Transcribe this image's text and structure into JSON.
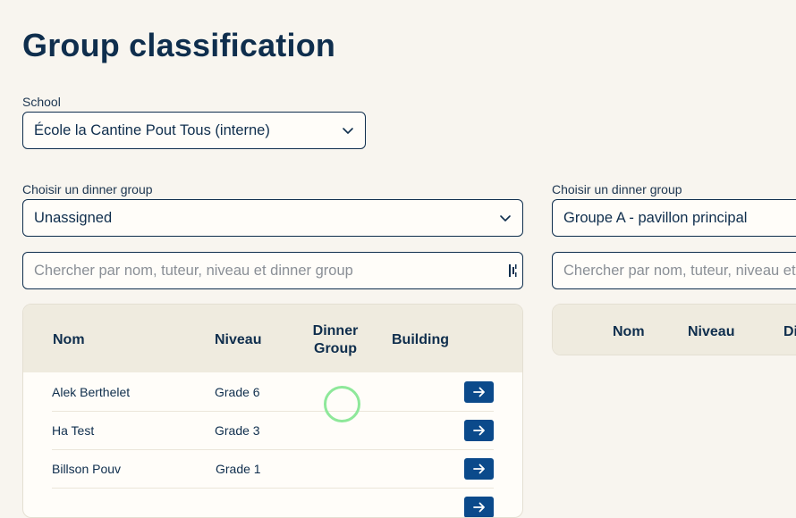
{
  "page": {
    "title": "Group classification"
  },
  "school": {
    "label": "School",
    "selected": "École la Cantine Pout Tous (interne)"
  },
  "left": {
    "group_label": "Choisir un dinner group",
    "group_selected": "Unassigned",
    "search_placeholder": "Chercher par nom, tuteur, niveau et dinner group",
    "table": {
      "headers": {
        "nom": "Nom",
        "niveau": "Niveau",
        "dinner_group_1": "Dinner",
        "dinner_group_2": "Group",
        "building": "Building"
      },
      "rows": [
        {
          "nom": "Alek Berthelet",
          "niveau": "Grade 6"
        },
        {
          "nom": "Ha Test",
          "niveau": "Grade 3"
        },
        {
          "nom": "Billson Pouv",
          "niveau": "Grade 1"
        },
        {
          "nom": "",
          "niveau": ""
        }
      ]
    }
  },
  "right": {
    "group_label": "Choisir un dinner group",
    "group_selected": "Groupe A - pavillon principal",
    "search_placeholder": "Chercher par nom, tuteur, niveau et dinner group",
    "table": {
      "headers": {
        "nom": "Nom",
        "niveau": "Niveau",
        "dinner_group_partial": "Di"
      }
    }
  },
  "icons": {
    "select_chevron": "chevron-down-icon",
    "row_action": "arrow-right-icon",
    "search_addon": "barcode-scan-icon"
  },
  "colors": {
    "background": "#f8f5ef",
    "primary": "#0f2e4d",
    "action_button": "#0b4a8b",
    "table_header": "#efebdf",
    "click_indicator": "#8ee89a"
  }
}
